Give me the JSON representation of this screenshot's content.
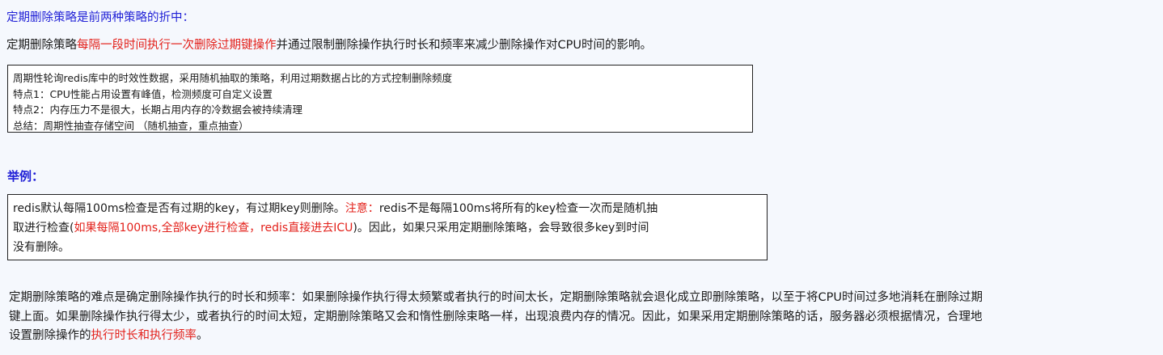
{
  "heading": "定期删除策略是前两种策略的折中：",
  "intro": {
    "pre": "定期删除策略",
    "highlight": "每隔一段时间执行一次删除过期键操作",
    "post": "并通过限制删除操作执行时长和频率来减少删除操作对CPU时间的影响。"
  },
  "summary_box": {
    "lines": [
      "周期性轮询redis库中的时效性数据，采用随机抽取的策略，利用过期数据占比的方式控制删除频度",
      "特点1：CPU性能占用设置有峰值，检测频度可自定义设置",
      "特点2：内存压力不是很大，长期占用内存的冷数据会被持续清理",
      "总结：周期性抽查存储空间 （随机抽查，重点抽查）"
    ]
  },
  "example": {
    "title": "举例：",
    "line1_a": "redis默认每隔100ms检查是否有过期的key，有过期key则删除。",
    "line1_note": "注意：",
    "line1_b": "redis不是每隔100ms将所有的key检查一次而是随机抽",
    "line2_a": "取进行检查(",
    "line2_red": "如果每隔100ms,全部key进行检查，redis直接进去ICU",
    "line2_b": ")。因此，如果只采用定期删除策略，会导致很多key到时间",
    "line3": "没有删除。"
  },
  "paragraph": {
    "line1": "定期删除策略的难点是确定删除操作执行的时长和频率：如果删除操作执行得太频繁或者执行的时间太长，定期删除策略就会退化成立即删除策略，以至于将CPU时间过多地消耗在删除过期",
    "line2": "键上面。如果删除操作执行得太少，或者执行的时间太短，定期删除策略又会和惰性删除束略一样，出现浪费内存的情况。因此，如果采用定期删除策略的话，服务器必须根据情况，合理地",
    "line3_a": "设置删除操作的",
    "line3_red": "执行时长和执行频率",
    "line3_b": "。"
  },
  "colors": {
    "heading_blue": "#1f1fd6",
    "highlight_red": "#e3211b"
  }
}
